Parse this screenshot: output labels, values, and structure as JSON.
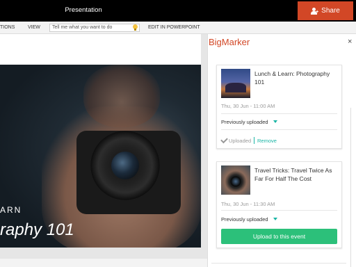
{
  "window": {
    "title": "Presentation",
    "share_label": "Share"
  },
  "ribbon": {
    "tabs": [
      "TIONS",
      "VIEW"
    ],
    "tell_me": "Tell me what you want to do",
    "edit_label": "EDIT IN POWERPOINT"
  },
  "slide": {
    "line1": "ARN",
    "line2": "raphy 101"
  },
  "panel": {
    "title": "BigMarker",
    "close": "×",
    "events": [
      {
        "title": "Lunch & Learn: Photography 101",
        "date": "Thu, 30 Jun - 11:00 AM",
        "status": "Previously uploaded",
        "uploaded_label": "Uploaded",
        "remove_label": "Remove"
      },
      {
        "title": "Travel Tricks: Travel Twice As Far For Half The Cost",
        "date": "Thu, 30 Jun - 11:30 AM",
        "status": "Previously uploaded",
        "upload_label": "Upload to this event"
      }
    ]
  },
  "colors": {
    "accent": "#d24726",
    "teal": "#1ab5a5",
    "green": "#2cc07a"
  },
  "icons": [
    "person-add-icon",
    "lightbulb-icon",
    "close-icon",
    "caret-down-icon",
    "check-icon"
  ]
}
